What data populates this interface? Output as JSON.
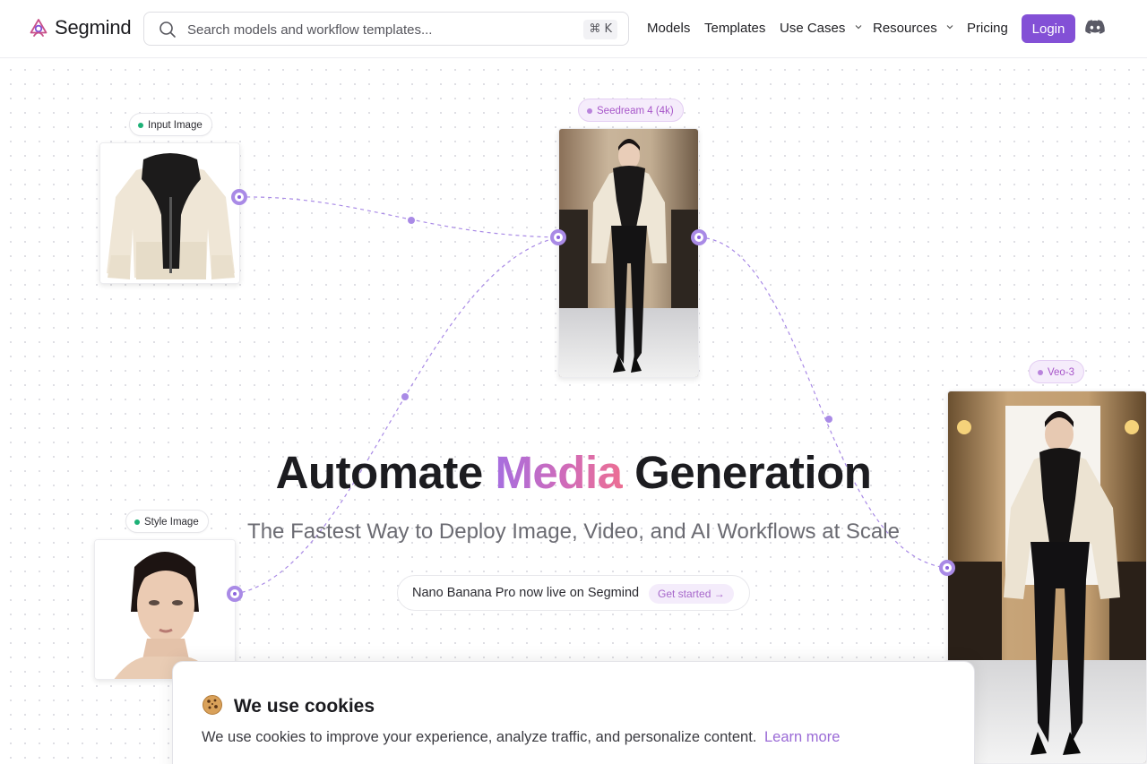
{
  "header": {
    "brand": "Segmind",
    "search_placeholder": "Search models and workflow templates...",
    "shortcut": "⌘ K",
    "nav": {
      "models": "Models",
      "templates": "Templates",
      "use_cases": "Use Cases",
      "resources": "Resources",
      "pricing": "Pricing"
    },
    "login": "Login"
  },
  "nodes": {
    "input_image": "Input Image",
    "seedream": "Seedream 4 (4k)",
    "style_image": "Style Image",
    "veo": "Veo-3"
  },
  "hero": {
    "title_pre": "Automate",
    "title_accent": "Media",
    "title_post": "Generation",
    "subtitle": "The Fastest Way to Deploy Image, Video, and AI Workflows at Scale",
    "announcement": "Nano Banana Pro now live on Segmind",
    "announcement_cta": "Get started →"
  },
  "cookie": {
    "title": "We use cookies",
    "body": "We use cookies to improve your experience, analyze traffic, and personalize content.",
    "link": "Learn more"
  },
  "colors": {
    "accent": "#8350d6",
    "port": "#a98ae6",
    "green_dot": "#1db177"
  },
  "icons": [
    "segmind-logo-icon",
    "search-icon",
    "chevron-down-icon",
    "discord-icon",
    "cookie-icon"
  ]
}
